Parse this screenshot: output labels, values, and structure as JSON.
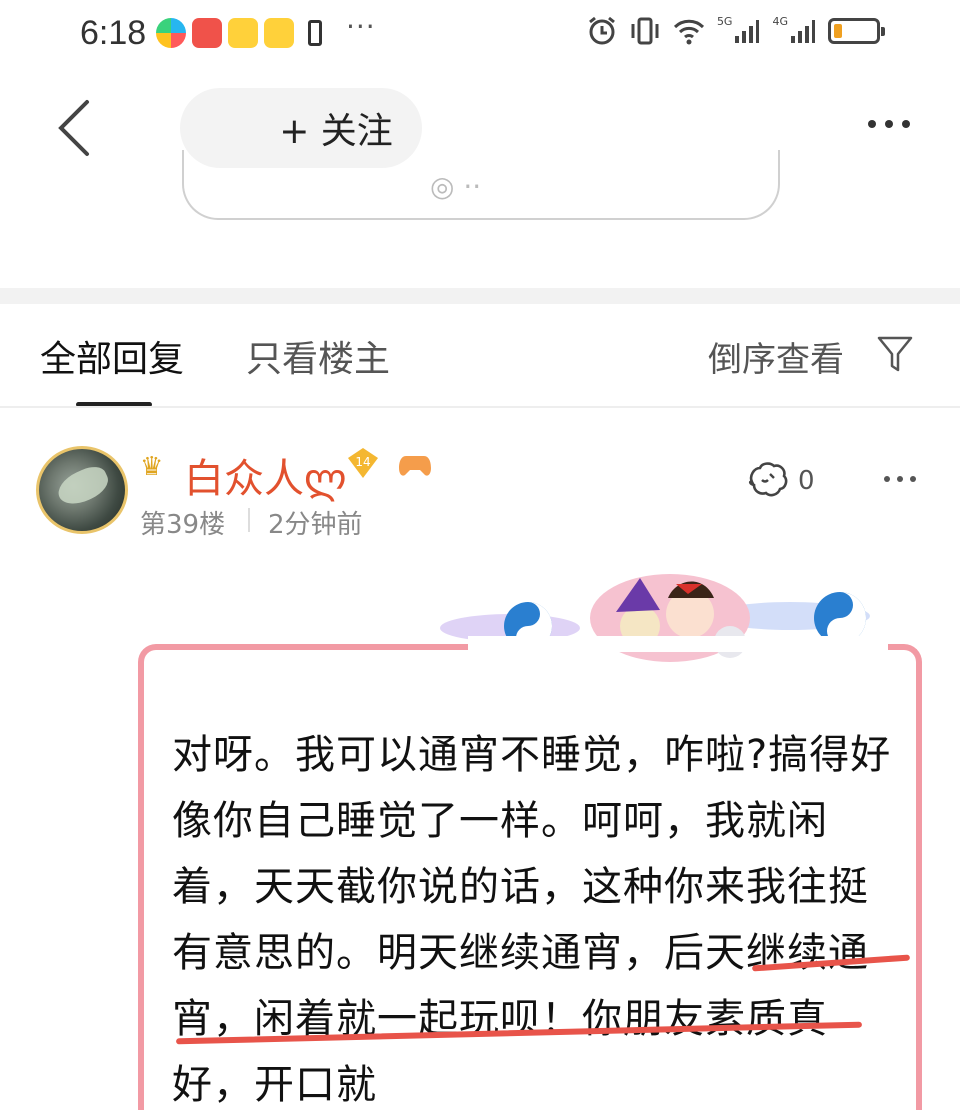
{
  "status_bar": {
    "time": "6:18",
    "more": "···",
    "signal1_label": "5G",
    "signal2_label": "4G",
    "battery_level": 0.2,
    "icons": [
      "app-store-icon",
      "huawei-icon",
      "weibo-icon",
      "weibo-icon",
      "notification-icon",
      "alarm-icon",
      "vibrate-icon",
      "wifi-icon",
      "signal-icon",
      "battery-icon"
    ]
  },
  "nav": {
    "follow_label": "+ 关注"
  },
  "tabs": {
    "all": "全部回复",
    "owner_only": "只看楼主",
    "sort": "倒序查看"
  },
  "reply": {
    "username": "白众人ლ",
    "level": "14",
    "floor": "第39楼",
    "time": "2分钟前",
    "likes": "0",
    "text": "对呀。我可以通宵不睡觉，咋啦?搞得好像你自己睡觉了一样。呵呵，我就闲着，天天截你说的话，这种你来我往挺有意思的。明天继续通宵，后天继续通宵，闲着就一起玩呗！你朋友素质真好，开口就"
  },
  "colors": {
    "username": "#e2512e",
    "bubble_border": "#f29aa4",
    "strike": "#e8544a"
  }
}
